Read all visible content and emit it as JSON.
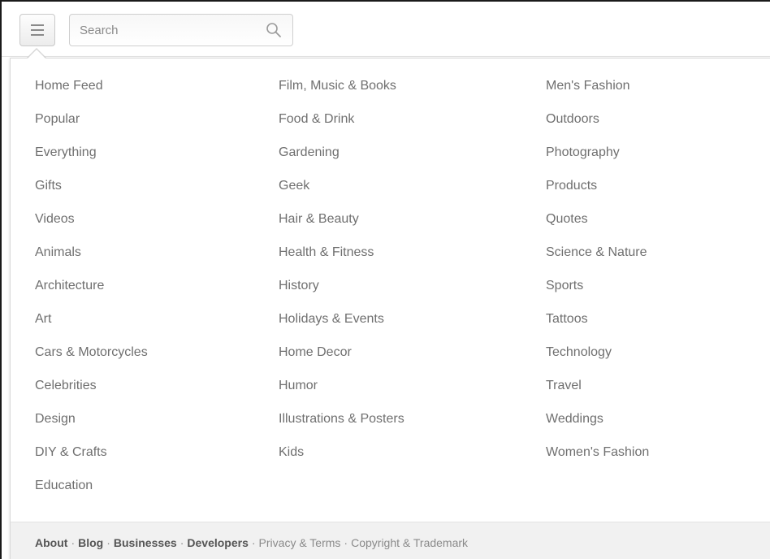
{
  "search": {
    "placeholder": "Search"
  },
  "menu": {
    "columns": [
      [
        "Home Feed",
        "Popular",
        "Everything",
        "Gifts",
        "Videos",
        "Animals",
        "Architecture",
        "Art",
        "Cars & Motorcycles",
        "Celebrities",
        "Design",
        "DIY & Crafts",
        "Education"
      ],
      [
        "Film, Music & Books",
        "Food & Drink",
        "Gardening",
        "Geek",
        "Hair & Beauty",
        "Health & Fitness",
        "History",
        "Holidays & Events",
        "Home Decor",
        "Humor",
        "Illustrations & Posters",
        "Kids"
      ],
      [
        "Men's Fashion",
        "Outdoors",
        "Photography",
        "Products",
        "Quotes",
        "Science & Nature",
        "Sports",
        "Tattoos",
        "Technology",
        "Travel",
        "Weddings",
        "Women's Fashion"
      ]
    ]
  },
  "footer": {
    "links": [
      {
        "label": "About",
        "strong": true
      },
      {
        "label": "Blog",
        "strong": true
      },
      {
        "label": "Businesses",
        "strong": true
      },
      {
        "label": "Developers",
        "strong": true
      },
      {
        "label": "Privacy & Terms",
        "strong": false
      },
      {
        "label": "Copyright & Trademark",
        "strong": false
      }
    ],
    "separator": "·"
  },
  "colors": {
    "link_text": "#6f6f6f",
    "footer_strong": "#555555",
    "footer_bg": "#f1f1f1"
  },
  "icons": {
    "menu": "hamburger-icon",
    "search": "search-icon"
  }
}
